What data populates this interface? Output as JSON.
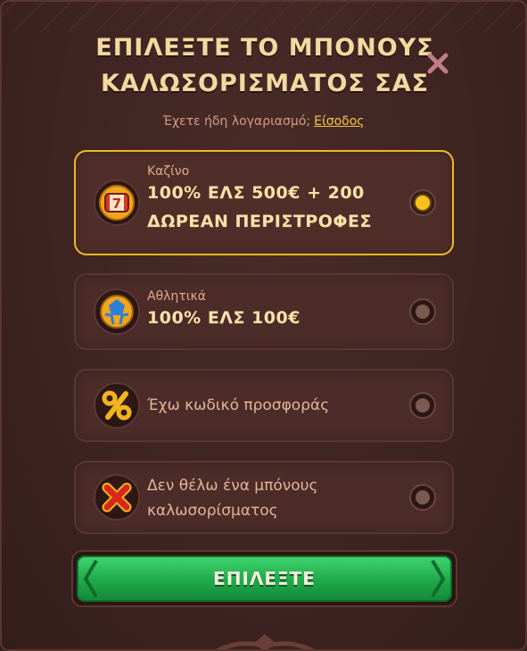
{
  "header": {
    "title_line1": "ΕΠΙΛΕΞΤΕ ΤΟ ΜΠΟΝΟΥΣ",
    "title_line2": "ΚΑΛΩΣΟΡΙΣΜΑΤΟΣ ΣΑΣ",
    "close_icon": "close-x-icon"
  },
  "login_prompt": {
    "text": "Έχετε ήδη λογαριασμό;",
    "link": "Είσοδος"
  },
  "options": [
    {
      "label": "Καζίνο",
      "value_line1": "100% ΕΛΣ 500€ + 200",
      "value_line2": "ΔΩΡΕΑΝ ΠΕΡΙΣΤΡΟΦΕΣ",
      "icon": "slot-reel-icon",
      "selected": true
    },
    {
      "label": "Αθλητικά",
      "value_line1": "100% ΕΛΣ 100€",
      "icon": "football-icon",
      "selected": false
    },
    {
      "text": "Έχω κωδικό προσφοράς",
      "icon": "percent-icon",
      "selected": false
    },
    {
      "text_line1": "Δεν θέλω ένα μπόνους",
      "text_line2": "καλωσορίσματος",
      "icon": "red-x-icon",
      "selected": false
    }
  ],
  "cta": {
    "label": "ΕΠΙΛΕΞΤΕ"
  },
  "colors": {
    "accent_gold": "#f1b91e",
    "button_green": "#1fa94a",
    "background": "#3e2422"
  }
}
